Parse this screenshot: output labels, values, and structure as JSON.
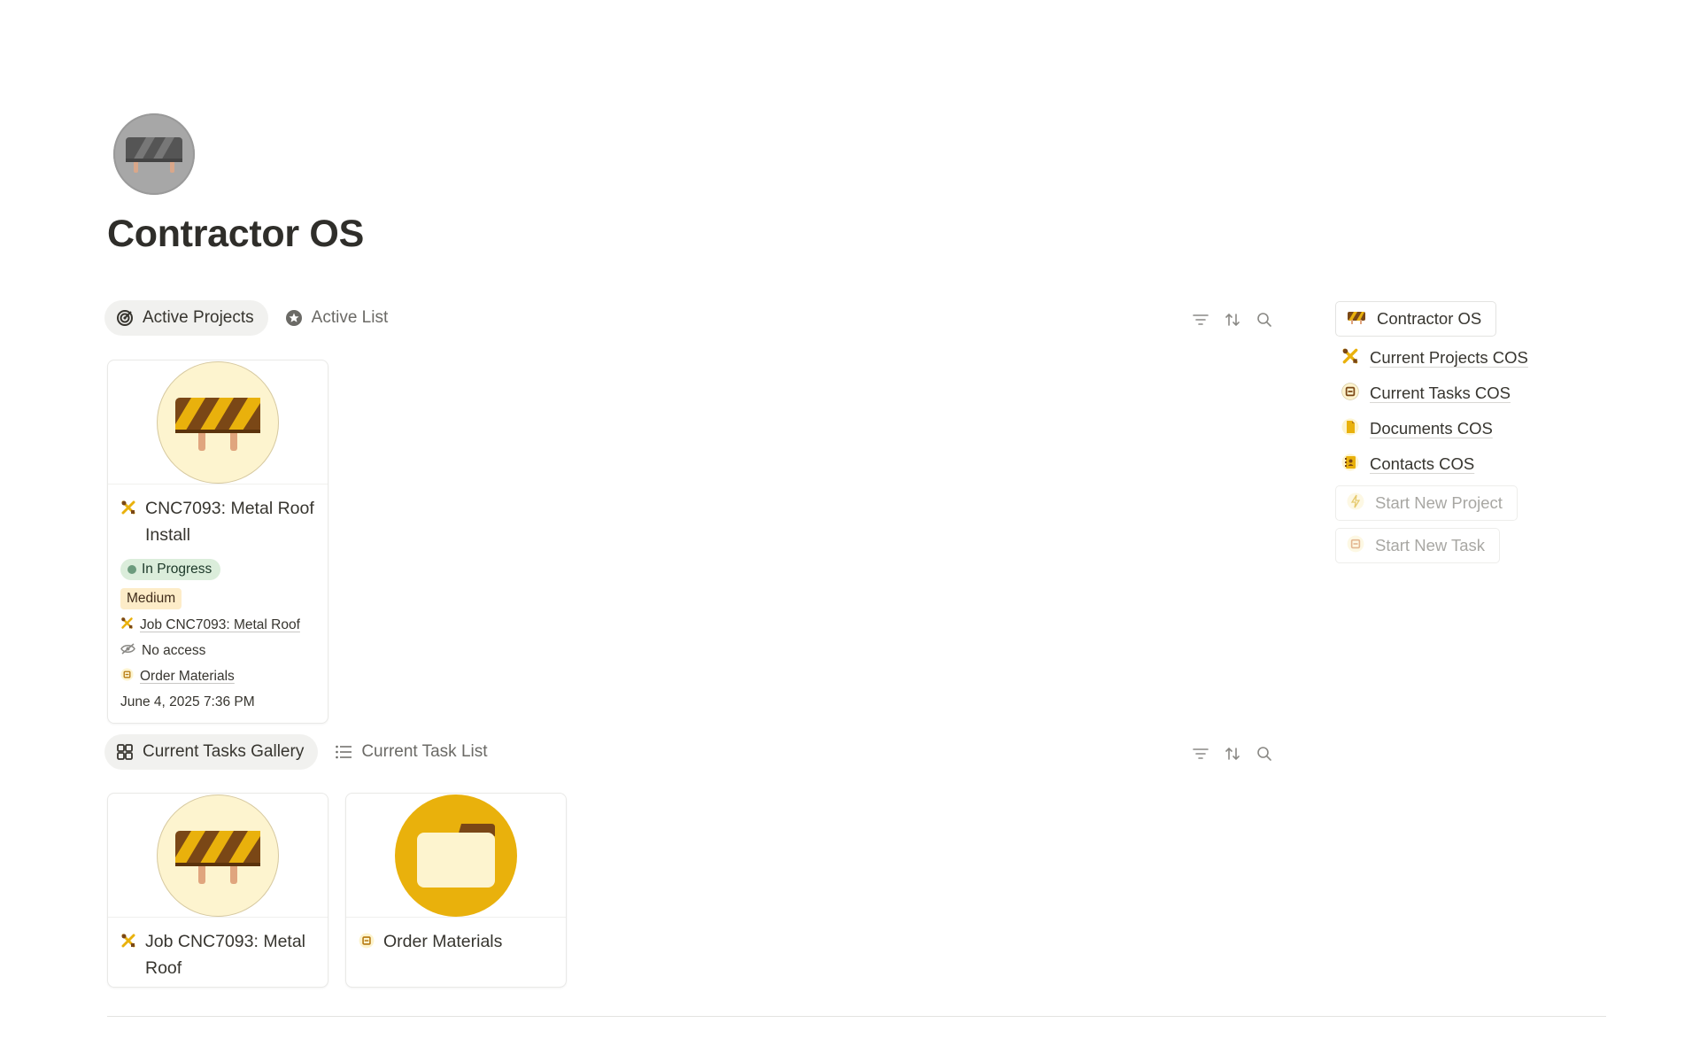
{
  "page": {
    "title": "Contractor OS",
    "icon": "barricade-icon"
  },
  "projects_view": {
    "tabs": [
      {
        "label": "Active Projects",
        "icon": "target-icon",
        "active": true
      },
      {
        "label": "Active List",
        "icon": "star-circle-icon",
        "active": false
      }
    ],
    "cards": [
      {
        "title": "CNC7093: Metal Roof Install",
        "title_icon": "tools-icon",
        "cover_icon": "barricade-icon",
        "status": "In Progress",
        "priority": "Medium",
        "job": "Job CNC7093: Metal Roof",
        "access": "No access",
        "task": "Order Materials",
        "date": "June 4, 2025 7:36 PM"
      }
    ]
  },
  "tasks_view": {
    "tabs": [
      {
        "label": "Current Tasks Gallery",
        "icon": "gallery-icon",
        "active": true
      },
      {
        "label": "Current Task List",
        "icon": "list-icon",
        "active": false
      }
    ],
    "cards": [
      {
        "title": "Job CNC7093: Metal Roof",
        "title_icon": "tools-icon",
        "cover_icon": "barricade-icon"
      },
      {
        "title": "Order Materials",
        "title_icon": "task-box-icon",
        "cover_icon": "folder-icon"
      }
    ]
  },
  "sidebar": {
    "home_button": "Contractor OS",
    "links": [
      {
        "label": "Current Projects COS",
        "icon": "tools-icon"
      },
      {
        "label": "Current Tasks COS",
        "icon": "task-box-icon"
      },
      {
        "label": "Documents COS",
        "icon": "document-icon"
      },
      {
        "label": "Contacts COS",
        "icon": "contacts-icon"
      }
    ],
    "actions": [
      {
        "label": "Start New Project",
        "icon": "lightning-icon"
      },
      {
        "label": "Start New Task",
        "icon": "task-box-icon"
      }
    ]
  },
  "colors": {
    "accent_yellow": "#e9b10c",
    "status_green_bg": "#dbeddb",
    "priority_bg": "#fdecc8",
    "text": "#37352f"
  }
}
